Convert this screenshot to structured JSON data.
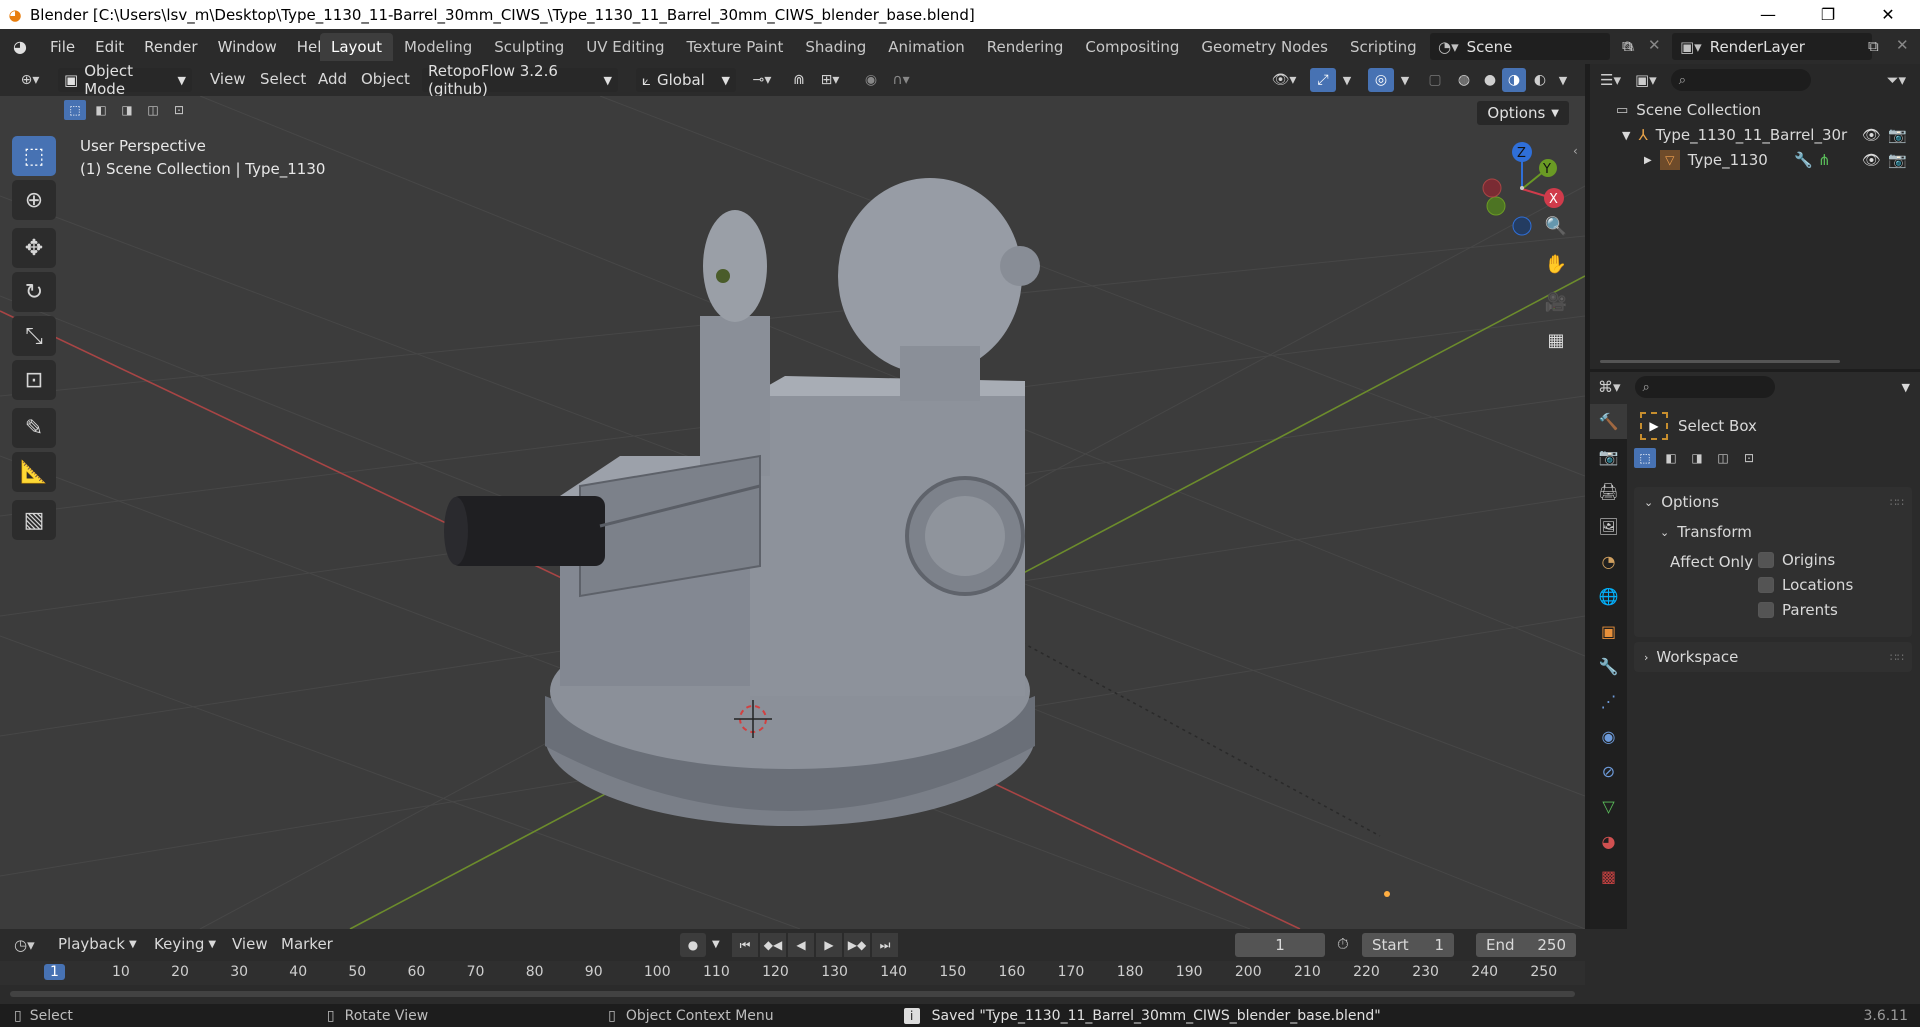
{
  "window": {
    "title": "Blender [C:\\Users\\lsv_m\\Desktop\\Type_1130_11-Barrel_30mm_CIWS_\\Type_1130_11_Barrel_30mm_CIWS_blender_base.blend]",
    "minimize": "—",
    "maximize": "❐",
    "close": "✕"
  },
  "menu": [
    "File",
    "Edit",
    "Render",
    "Window",
    "Help"
  ],
  "workspaces": [
    "Layout",
    "Modeling",
    "Sculpting",
    "UV Editing",
    "Texture Paint",
    "Shading",
    "Animation",
    "Rendering",
    "Compositing",
    "Geometry Nodes",
    "Scripting"
  ],
  "active_workspace": "Layout",
  "scene": "Scene",
  "render_layer": "RenderLayer",
  "header": {
    "mode": "Object Mode",
    "menus": [
      "View",
      "Select",
      "Add",
      "Object"
    ],
    "addon": "RetopoFlow 3.2.6 (github)",
    "orientation": "Global",
    "options": "Options"
  },
  "viewport": {
    "perspective": "User Perspective",
    "collection": "(1) Scene Collection | Type_1130"
  },
  "gizmo": {
    "z": "Z",
    "y": "Y",
    "x": "X"
  },
  "outliner": {
    "root": "Scene Collection",
    "items": [
      "Type_1130_11_Barrel_30r",
      "Type_1130"
    ]
  },
  "properties": {
    "tool": "Select Box",
    "options": "Options",
    "transform": "Transform",
    "affect_only": "Affect Only",
    "checks": [
      "Origins",
      "Locations",
      "Parents"
    ],
    "workspace": "Workspace"
  },
  "timeline": {
    "menus": [
      "Playback",
      "Keying",
      "View",
      "Marker"
    ],
    "current_frame": "1",
    "start_label": "Start",
    "start": "1",
    "end_label": "End",
    "end": "250",
    "ticks": [
      "1",
      "10",
      "20",
      "30",
      "40",
      "50",
      "60",
      "70",
      "80",
      "90",
      "100",
      "110",
      "120",
      "130",
      "140",
      "150",
      "160",
      "170",
      "180",
      "190",
      "200",
      "210",
      "220",
      "230",
      "240",
      "250"
    ]
  },
  "status": {
    "select": "Select",
    "rotate": "Rotate View",
    "context": "Object Context Menu",
    "message": "Saved \"Type_1130_11_Barrel_30mm_CIWS_blender_base.blend\"",
    "version": "3.6.11"
  },
  "colors": {
    "accent": "#4772b3",
    "orange": "#e87d0d"
  }
}
